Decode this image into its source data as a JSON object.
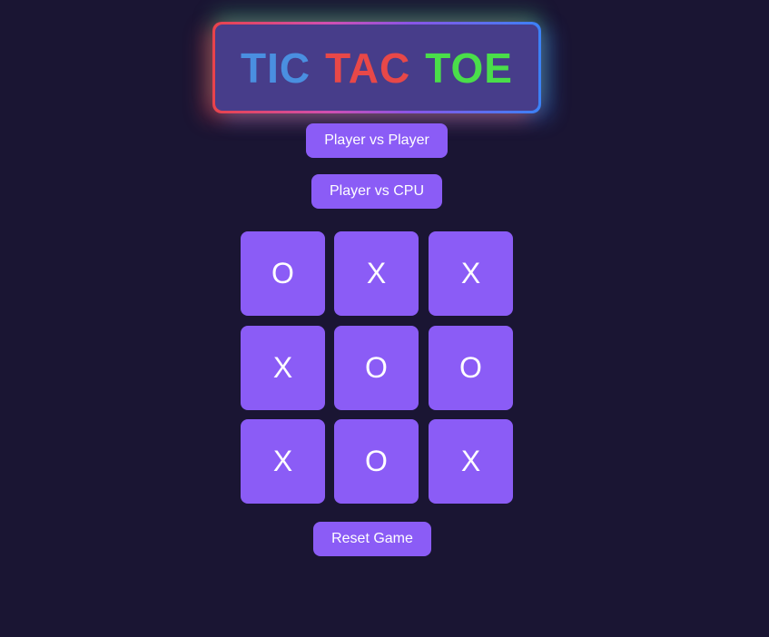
{
  "header": {
    "title_words": [
      {
        "text": "TIC",
        "color": "#4a8fe0"
      },
      {
        "text": "TAC",
        "color": "#e84848"
      },
      {
        "text": "TOE",
        "color": "#4ade4a"
      }
    ]
  },
  "modes": {
    "pvp_label": "Player vs Player",
    "cpu_label": "Player vs CPU"
  },
  "board": {
    "cells": [
      "O",
      "X",
      "X",
      "X",
      "O",
      "O",
      "X",
      "O",
      "X"
    ]
  },
  "controls": {
    "reset_label": "Reset Game"
  },
  "colors": {
    "background": "#1a1533",
    "button": "#8b5cf6",
    "title_fill": "#473d8a"
  }
}
